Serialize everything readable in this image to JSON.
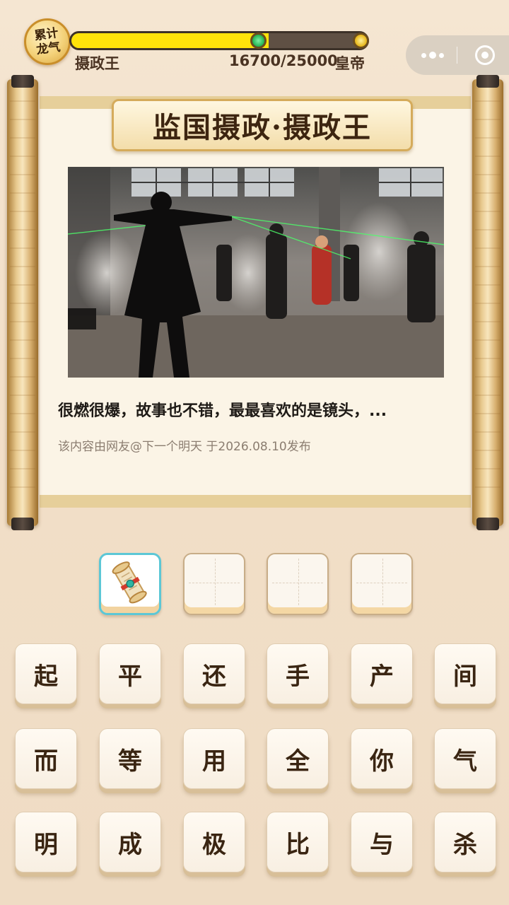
{
  "badge": {
    "label": "累计龙气"
  },
  "progress": {
    "fraction": 0.668,
    "current_rank": "摄政王",
    "score_text": "16700/25000",
    "next_rank": "皇帝"
  },
  "level": {
    "title": "监国摄政·摄政王"
  },
  "review": {
    "text": "很燃很爆，故事也不错，最最喜欢的是镜头，...",
    "credit": "该内容由网友@下一个明天 于2026.08.10发布"
  },
  "answer_slots": [
    {
      "state": "hint",
      "icon": "scroll-hint-icon"
    },
    {
      "state": "empty"
    },
    {
      "state": "empty"
    },
    {
      "state": "empty"
    }
  ],
  "keyboard": {
    "rows": [
      [
        "起",
        "平",
        "还",
        "手",
        "产",
        "间"
      ],
      [
        "而",
        "等",
        "用",
        "全",
        "你",
        "气"
      ],
      [
        "明",
        "成",
        "极",
        "比",
        "与",
        "杀"
      ]
    ]
  },
  "colors": {
    "progress_fill": "#ffe30a",
    "progress_track": "#5f5044",
    "key_text": "#3a2512",
    "hint_border": "#5cc7d6"
  }
}
